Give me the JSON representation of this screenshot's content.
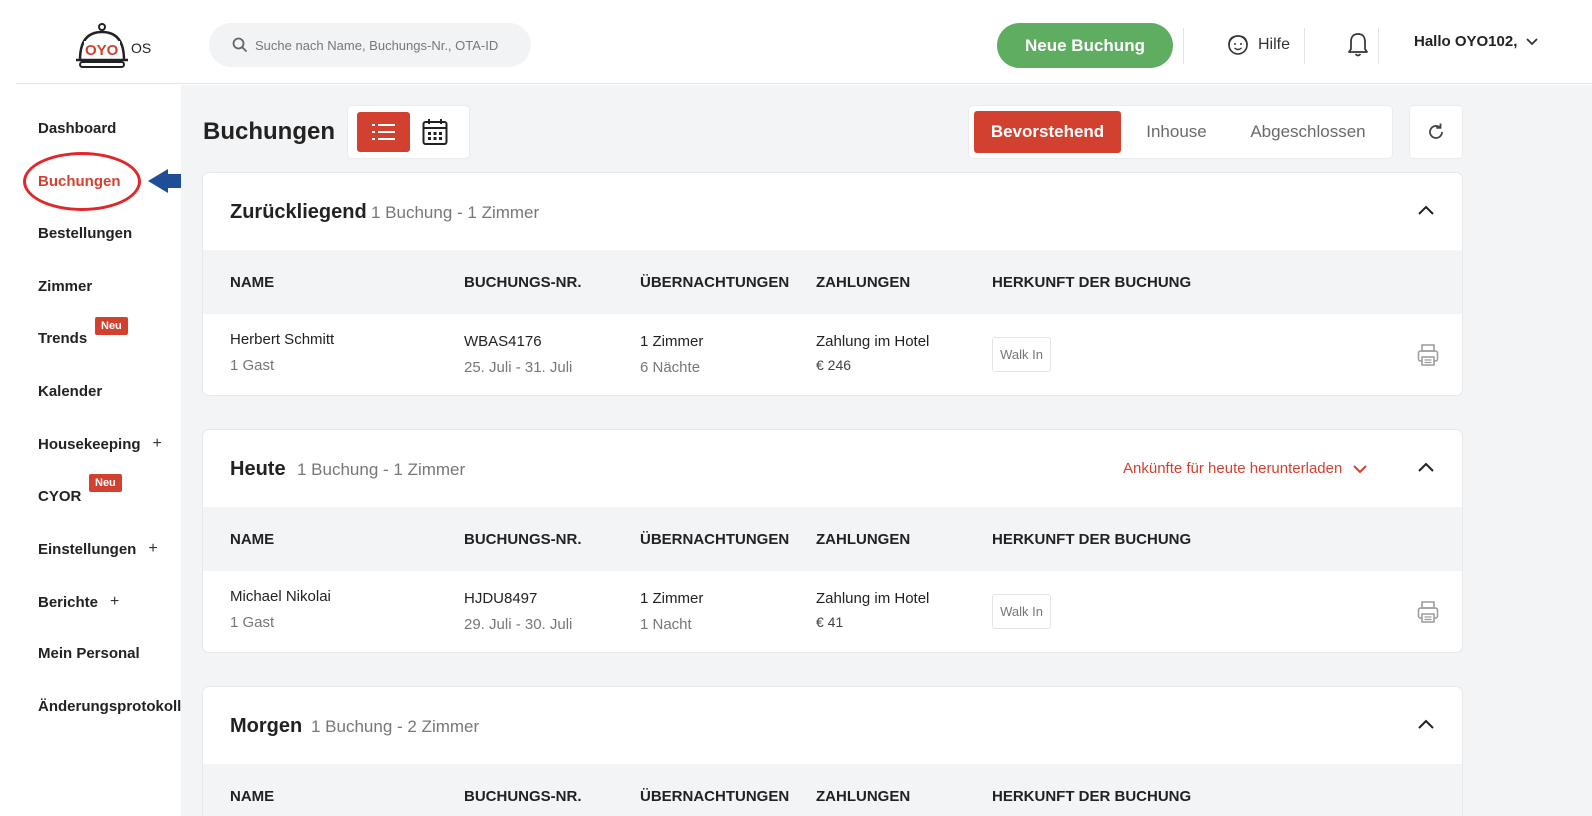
{
  "header": {
    "logo_brand": "OYO",
    "logo_suffix": "OS",
    "search_placeholder": "Suche nach Name, Buchungs-Nr., OTA-ID",
    "new_booking_label": "Neue Buchung",
    "help_label": "Hilfe",
    "user_greeting": "Hallo OYO102,"
  },
  "sidebar": {
    "items": [
      {
        "label": "Dashboard"
      },
      {
        "label": "Buchungen"
      },
      {
        "label": "Bestellungen"
      },
      {
        "label": "Zimmer"
      },
      {
        "label": "Trends",
        "badge": "Neu"
      },
      {
        "label": "Kalender"
      },
      {
        "label": "Housekeeping",
        "expand": "+"
      },
      {
        "label": "CYOR",
        "badge": "Neu"
      },
      {
        "label": "Einstellungen",
        "expand": "+"
      },
      {
        "label": "Berichte",
        "expand": "+"
      },
      {
        "label": "Mein Personal"
      },
      {
        "label": "Änderungsprotokoll"
      }
    ]
  },
  "main": {
    "title": "Buchungen",
    "tabs": [
      {
        "label": "Bevorstehend",
        "active": true
      },
      {
        "label": "Inhouse",
        "active": false
      },
      {
        "label": "Abgeschlossen",
        "active": false
      }
    ],
    "columns": {
      "name": "NAME",
      "booking_no": "BUCHUNGS-NR.",
      "nights": "ÜBERNACHTUNGEN",
      "payments": "ZAHLUNGEN",
      "source": "HERKUNFT DER BUCHUNG"
    },
    "sections": [
      {
        "title": "Zurückliegend",
        "subtitle": "1 Buchung - 1 Zimmer",
        "rows": [
          {
            "name": "Herbert Schmitt",
            "guests": "1 Gast",
            "booking_no": "WBAS4176",
            "dates": "25. Juli - 31. Juli",
            "rooms": "1 Zimmer",
            "nights": "6 Nächte",
            "payment": "Zahlung im Hotel",
            "amount": "€ 246",
            "source": "Walk In"
          }
        ]
      },
      {
        "title": "Heute",
        "subtitle": "1 Buchung - 1 Zimmer",
        "download_label": "Ankünfte für heute herunterladen",
        "rows": [
          {
            "name": "Michael Nikolai",
            "guests": "1 Gast",
            "booking_no": "HJDU8497",
            "dates": "29. Juli - 30. Juli",
            "rooms": "1 Zimmer",
            "nights": "1 Nacht",
            "payment": "Zahlung im Hotel",
            "amount": "€ 41",
            "source": "Walk In"
          }
        ]
      },
      {
        "title": "Morgen",
        "subtitle": "1 Buchung - 2 Zimmer",
        "rows": []
      }
    ]
  },
  "colors": {
    "accent": "#d2412f",
    "primary_button": "#5fad61",
    "annotation": "#e0282a",
    "arrow": "#1f4e96"
  }
}
